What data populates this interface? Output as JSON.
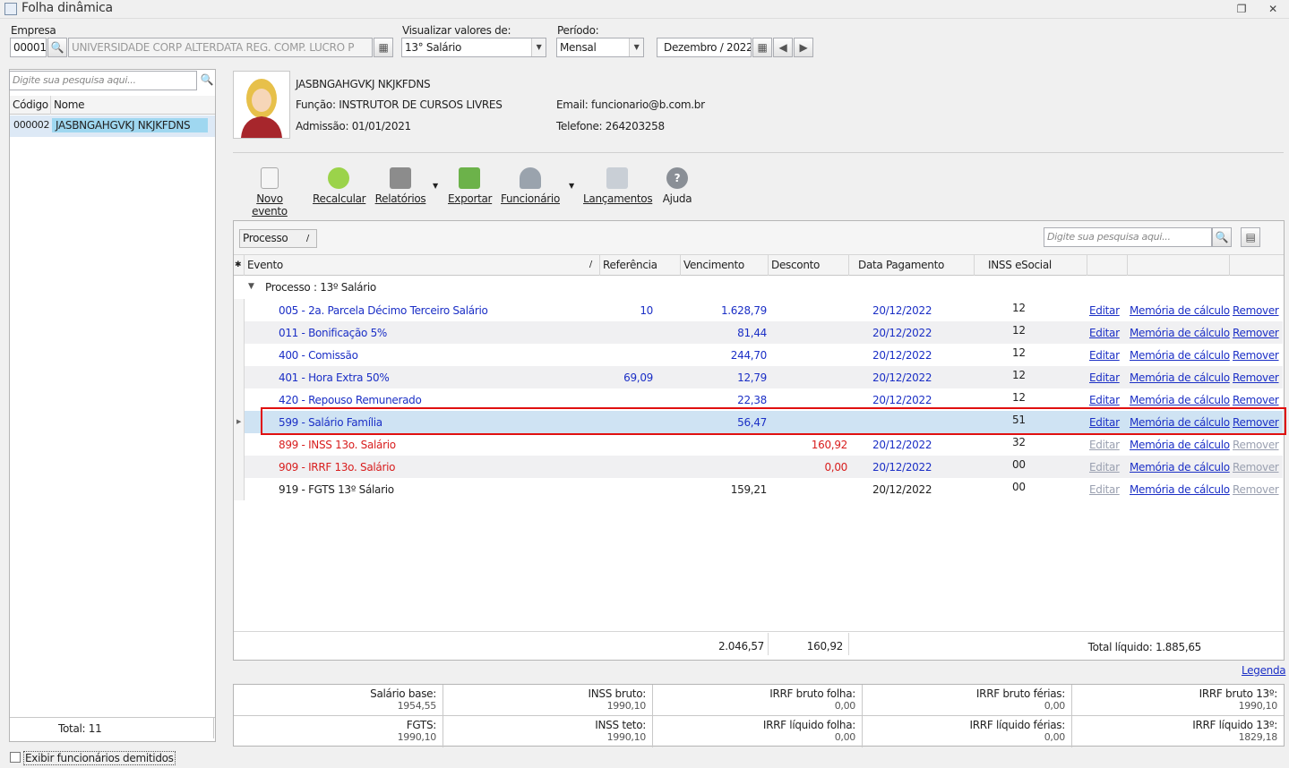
{
  "window": {
    "title": "Folha dinâmica"
  },
  "filters": {
    "empresa_label": "Empresa",
    "empresa_code": "00001",
    "empresa_name": "UNIVERSIDADE CORP ALTERDATA REG. COMP. LUCRO P",
    "visualizar_label": "Visualizar valores de:",
    "visualizar_value": "13° Salário",
    "periodo_label": "Período:",
    "periodo_value": "Mensal",
    "month_value": "Dezembro / 2022"
  },
  "employee_list": {
    "search_placeholder": "Digite sua pesquisa aqui...",
    "col_code": "Código",
    "col_name": "Nome",
    "rows": [
      {
        "code": "000002",
        "name": "JASBNGAHGVKJ NKJKFDNS"
      }
    ],
    "total": "Total: 11",
    "show_dismissed": "Exibir funcionários demitidos"
  },
  "employee": {
    "name": "JASBNGAHGVKJ NKJKFDNS",
    "funcao": "Função: INSTRUTOR DE CURSOS LIVRES",
    "admissao": "Admissão:  01/01/2021",
    "email": "Email: funcionario@b.com.br",
    "telefone": "Telefone: 264203258"
  },
  "toolbar": {
    "novo": "Novo evento",
    "recalcular": "Recalcular",
    "relatorios": "Relatórios",
    "exportar": "Exportar",
    "funcionario": "Funcionário",
    "lancamentos": "Lançamentos",
    "ajuda": "Ajuda"
  },
  "grid": {
    "group_chip": "Processo",
    "search_placeholder": "Digite sua pesquisa aqui...",
    "columns": {
      "evento": "Evento",
      "referencia": "Referência",
      "vencimento": "Vencimento",
      "desconto": "Desconto",
      "data_pagamento": "Data Pagamento",
      "inss": "INSS eSocial"
    },
    "group_label": "Processo : 13º Salário",
    "link_editar": "Editar",
    "link_memoria": "Memória de cálculo",
    "link_remover": "Remover",
    "rows": [
      {
        "evento": "005 - 2a. Parcela Décimo Terceiro Salário",
        "ref": "10",
        "venc": "1.628,79",
        "desc": "",
        "data": "20/12/2022",
        "inss": "12",
        "color": "blue",
        "links_enabled": true
      },
      {
        "evento": "011 - Bonificação  5%",
        "ref": "",
        "venc": "81,44",
        "desc": "",
        "data": "20/12/2022",
        "inss": "12",
        "color": "blue",
        "links_enabled": true
      },
      {
        "evento": "400 - Comissão",
        "ref": "",
        "venc": "244,70",
        "desc": "",
        "data": "20/12/2022",
        "inss": "12",
        "color": "blue",
        "links_enabled": true
      },
      {
        "evento": "401 - Hora Extra 50%",
        "ref": "69,09",
        "venc": "12,79",
        "desc": "",
        "data": "20/12/2022",
        "inss": "12",
        "color": "blue",
        "links_enabled": true
      },
      {
        "evento": "420 - Repouso Remunerado",
        "ref": "",
        "venc": "22,38",
        "desc": "",
        "data": "20/12/2022",
        "inss": "12",
        "color": "blue",
        "links_enabled": true
      },
      {
        "evento": "599 - Salário Família",
        "ref": "",
        "venc": "56,47",
        "desc": "",
        "data": "",
        "inss": "51",
        "color": "blue",
        "links_enabled": true,
        "selected": true
      },
      {
        "evento": "899 - INSS 13o. Salário",
        "ref": "",
        "venc": "",
        "desc": "160,92",
        "data": "20/12/2022",
        "inss": "32",
        "color": "red",
        "links_enabled": false
      },
      {
        "evento": "909 - IRRF 13o. Salário",
        "ref": "",
        "venc": "",
        "desc": "0,00",
        "data": "20/12/2022",
        "inss": "00",
        "color": "red",
        "links_enabled": false
      },
      {
        "evento": "919 - FGTS 13º Sálario",
        "ref": "",
        "venc": "159,21",
        "desc": "",
        "data": "20/12/2022",
        "inss": "00",
        "color": "blk",
        "links_enabled": false
      }
    ],
    "total_venc": "2.046,57",
    "total_desc": "160,92",
    "total_liquido": "Total líquido: 1.885,65"
  },
  "legenda": "Legenda",
  "summary": [
    [
      {
        "label": "Salário base:",
        "value": "1954,55"
      },
      {
        "label": "INSS bruto:",
        "value": "1990,10"
      },
      {
        "label": "IRRF bruto folha:",
        "value": "0,00"
      },
      {
        "label": "IRRF bruto férias:",
        "value": "0,00"
      },
      {
        "label": "IRRF bruto 13º:",
        "value": "1990,10"
      }
    ],
    [
      {
        "label": "FGTS:",
        "value": "1990,10"
      },
      {
        "label": "INSS teto:",
        "value": "1990,10"
      },
      {
        "label": "IRRF líquido folha:",
        "value": "0,00"
      },
      {
        "label": "IRRF líquido férias:",
        "value": "0,00"
      },
      {
        "label": "IRRF líquido 13º:",
        "value": "1829,18"
      }
    ]
  ],
  "colors": {
    "link": "#1b2fc6",
    "discount": "#d81e1e",
    "highlight": "#e01010",
    "selected_row": "#cfe3f3"
  }
}
